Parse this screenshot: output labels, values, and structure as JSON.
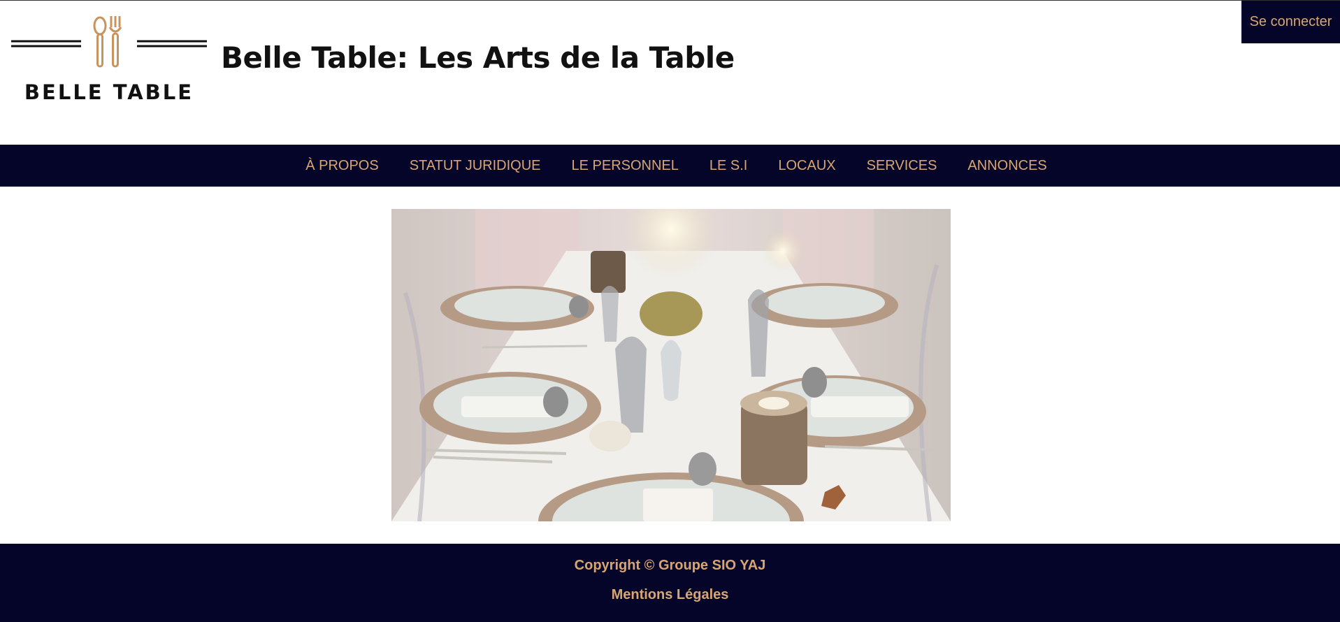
{
  "header": {
    "logo_text": "BELLE TABLE",
    "title": "Belle Table: Les Arts de la Table",
    "login_label": "Se connecter"
  },
  "nav": {
    "items": [
      {
        "label": "À PROPOS"
      },
      {
        "label": "STATUT JURIDIQUE"
      },
      {
        "label": "LE PERSONNEL"
      },
      {
        "label": "LE S.I"
      },
      {
        "label": "LOCAUX"
      },
      {
        "label": "SERVICES"
      },
      {
        "label": "ANNONCES"
      }
    ]
  },
  "footer": {
    "copyright": "Copyright © Groupe SIO YAJ",
    "mentions": "Mentions Légales"
  },
  "colors": {
    "navy": "#05052a",
    "accent": "#d9a672"
  }
}
